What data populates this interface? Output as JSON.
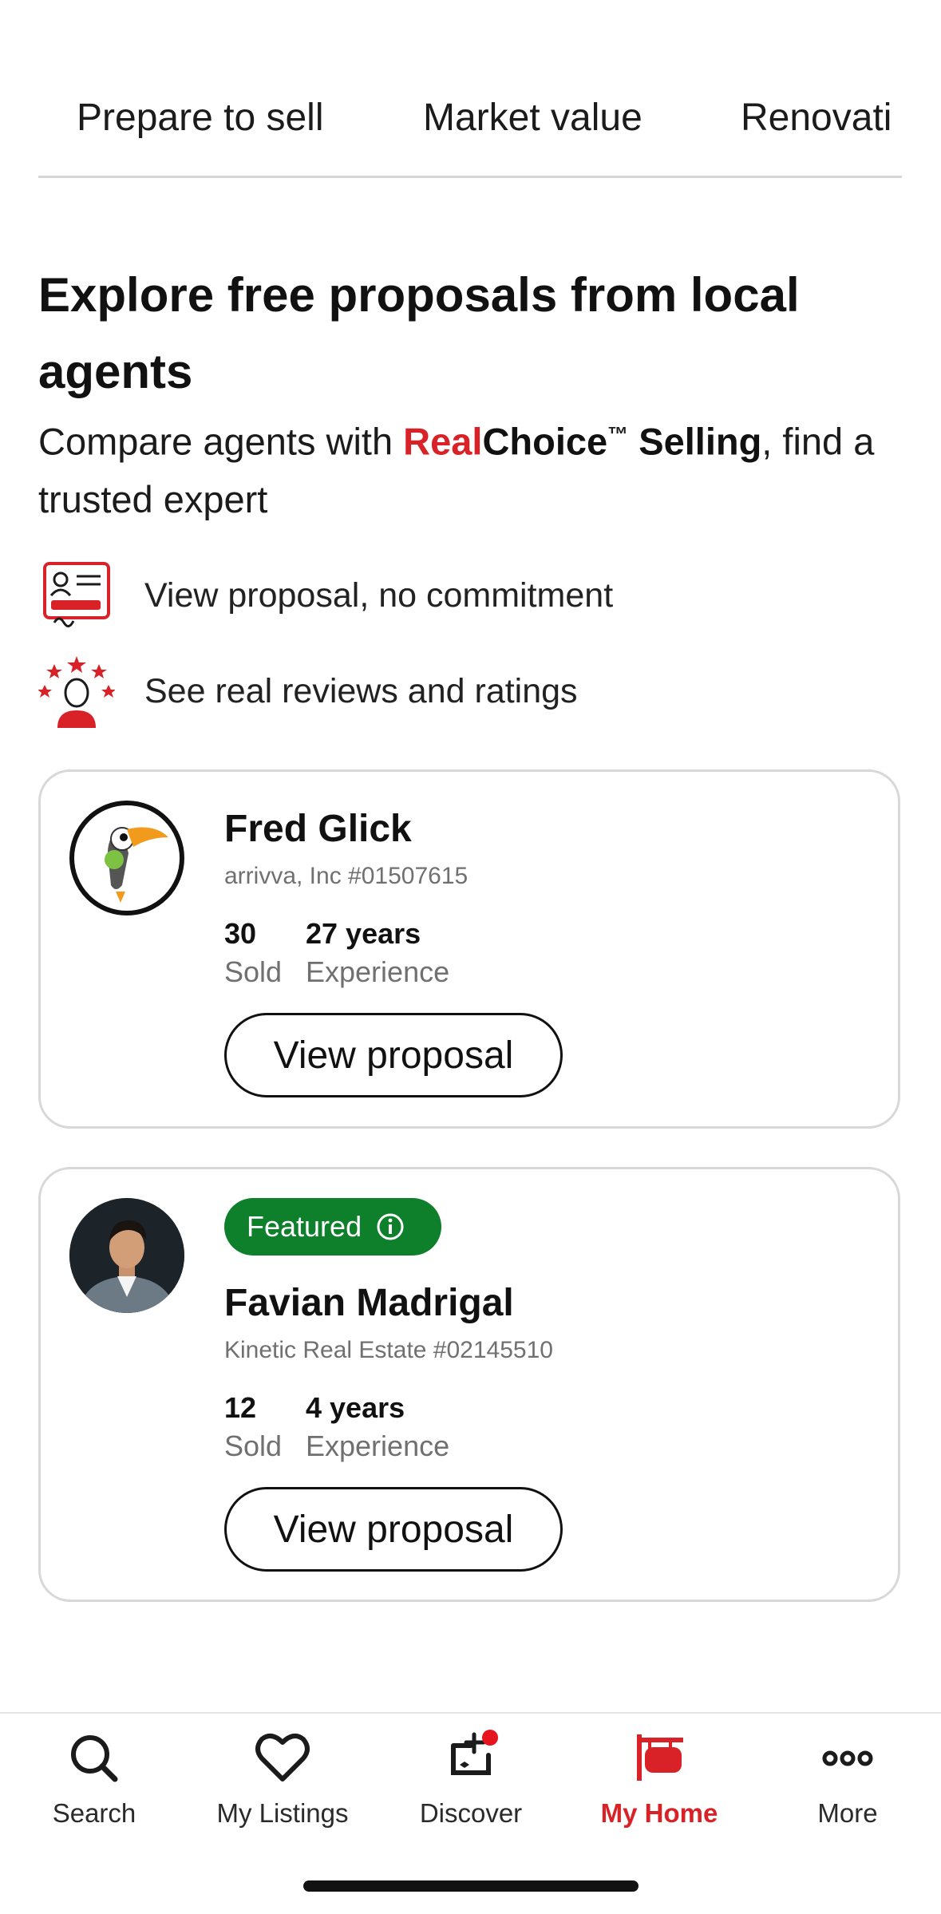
{
  "tabs": [
    {
      "label": "Prepare to sell",
      "active": true
    },
    {
      "label": "Market value",
      "active": false
    },
    {
      "label": "Renovati",
      "active": false
    }
  ],
  "hero": {
    "title": "Explore free proposals from local agents",
    "subtitle_prefix": "Compare agents with ",
    "brand_red": "Real",
    "brand_bold": "Choice",
    "brand_tm": "™",
    "brand_suffix": " Selling",
    "subtitle_suffix": ", find a trusted expert"
  },
  "features": [
    {
      "icon": "proposal-document-icon",
      "text": "View proposal, no commitment"
    },
    {
      "icon": "star-reviewer-icon",
      "text": "See real reviews and ratings"
    }
  ],
  "agents": [
    {
      "name": "Fred Glick",
      "brokerage": "arrivva, Inc  #01507615",
      "sold_value": "30",
      "sold_label": "Sold",
      "experience_value": "27 years",
      "experience_label": "Experience",
      "button": "View proposal",
      "featured": false,
      "avatar": "toucan-logo"
    },
    {
      "name": "Favian Madrigal",
      "brokerage": "Kinetic Real Estate  #02145510",
      "sold_value": "12",
      "sold_label": "Sold",
      "experience_value": "4 years",
      "experience_label": "Experience",
      "button": "View proposal",
      "featured": true,
      "featured_label": "Featured",
      "avatar": "agent-photo"
    }
  ],
  "nav": [
    {
      "label": "Search",
      "icon": "search-icon",
      "active": false
    },
    {
      "label": "My Listings",
      "icon": "heart-icon",
      "active": false
    },
    {
      "label": "Discover",
      "icon": "discover-icon",
      "active": false,
      "notification": true
    },
    {
      "label": "My Home",
      "icon": "home-sign-icon",
      "active": true
    },
    {
      "label": "More",
      "icon": "more-dots-icon",
      "active": false
    }
  ],
  "colors": {
    "brand_red": "#d92228",
    "featured_green": "#0e7f2a",
    "text": "#1b1b1b",
    "muted": "#707070"
  }
}
